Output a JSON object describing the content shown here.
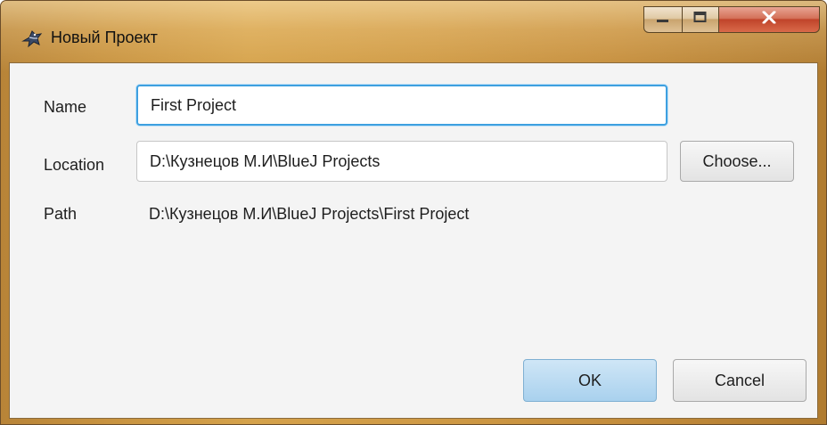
{
  "window": {
    "title": "Новый Проект",
    "icon": "bluej-bird-icon",
    "controls": [
      "minimize-icon",
      "maximize-icon",
      "close-icon"
    ]
  },
  "form": {
    "name_label": "Name",
    "name_value": "First Project",
    "location_label": "Location",
    "location_value": "D:\\Кузнецов М.И\\BlueJ Projects",
    "choose_label": "Choose...",
    "path_label": "Path",
    "path_value": "D:\\Кузнецов М.И\\BlueJ Projects\\First Project"
  },
  "buttons": {
    "ok_label": "OK",
    "cancel_label": "Cancel"
  },
  "colors": {
    "titlebar": "#c7923f",
    "focus_border": "#3ea0e0",
    "primary_button": "#a9d1ee",
    "close_button": "#c0442a"
  }
}
